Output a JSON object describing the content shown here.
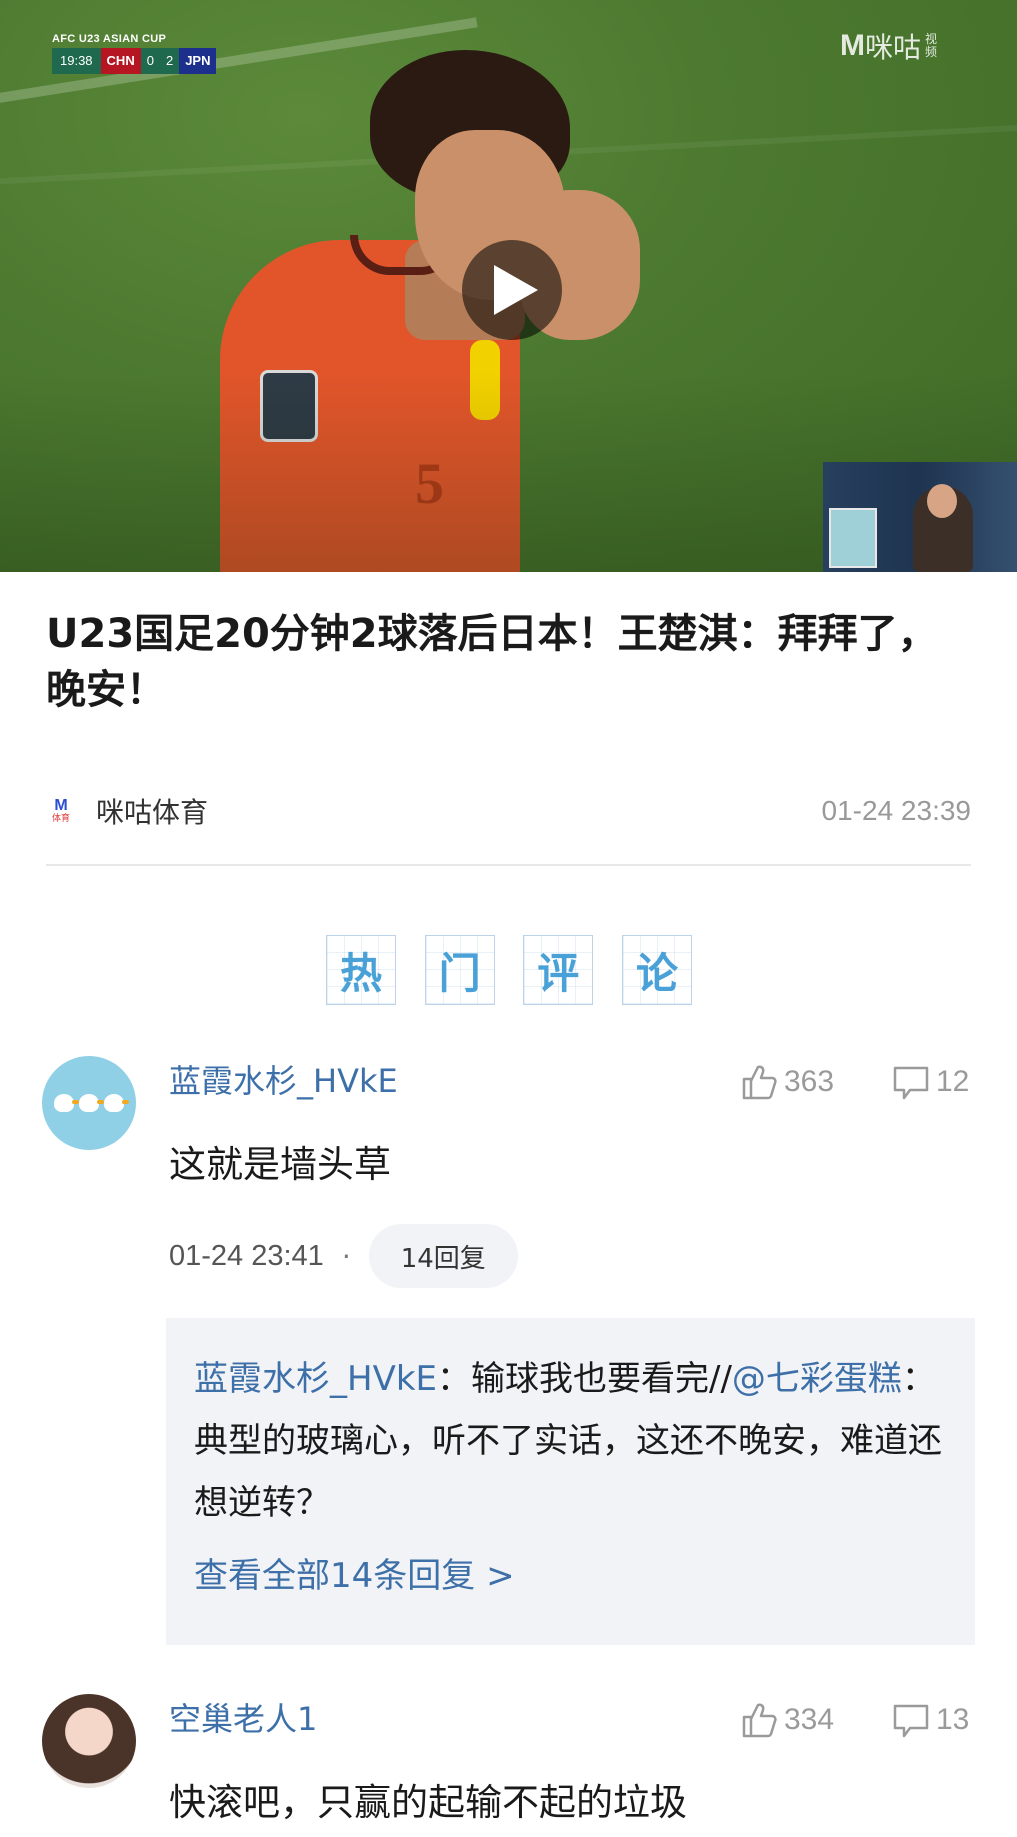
{
  "video": {
    "scorebug": {
      "competition": "AFC U23 ASIAN CUP",
      "clock": "19:38",
      "home": "CHN",
      "home_score": "0",
      "away_score": "2",
      "away": "JPN"
    },
    "watermark": {
      "mark": "M",
      "name": "咪咕",
      "sub": "视频"
    },
    "player_number": "5",
    "play_icon": "play-icon"
  },
  "article": {
    "title": "U23国足20分钟2球落后日本！王楚淇：拜拜了，晚安！",
    "source": {
      "logo_mark": "M",
      "logo_sub": "体育",
      "name": "咪咕体育",
      "time": "01-24 23:39"
    }
  },
  "hot_comments": {
    "chars": [
      "热",
      "门",
      "评",
      "论"
    ],
    "color": "#4aa1d8"
  },
  "comments": [
    {
      "user": "蓝霞水杉_HVkE",
      "likes": "363",
      "replies": "12",
      "text": "这就是墙头草",
      "time": "01-24 23:41",
      "dot": "·",
      "reply_pill": "14回复",
      "reply_preview": {
        "author": "蓝霞水杉_HVkE",
        "separator": "：",
        "body": "输球我也要看完//",
        "mention": "@七彩蛋糕",
        "mention_sep": "：",
        "quoted": "典型的玻璃心，听不了实话，这还不晚安，难道还想逆转？",
        "view_all": "查看全部14条回复 >"
      }
    },
    {
      "user": "空巢老人1",
      "likes": "334",
      "replies": "13",
      "text": "快滚吧，只赢的起输不起的垃圾"
    }
  ],
  "colors": {
    "link_blue": "#3d6fa8",
    "muted_gray": "#9a9a9a",
    "reply_bg": "#f2f3f6"
  }
}
